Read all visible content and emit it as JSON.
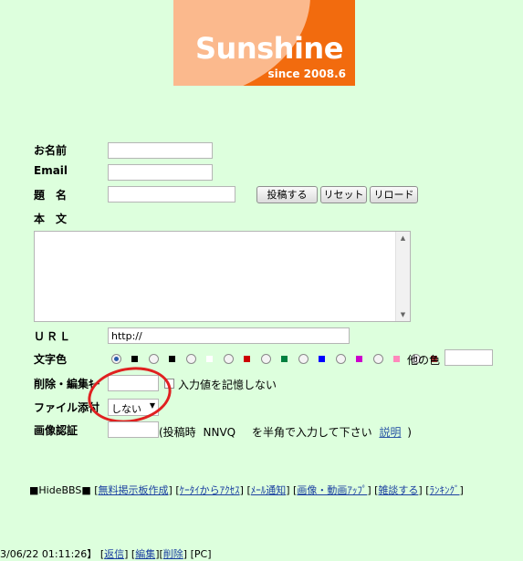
{
  "logo": {
    "brand": "Sunshine",
    "since": "since 2008.6"
  },
  "form": {
    "name_label": "お名前",
    "email_label": "Email",
    "subject_label": "題　名",
    "body_label": "本　文",
    "url_label": "ＵＲＬ",
    "url_value": "http://",
    "color_label": "文字色",
    "color_options": [
      "#000000",
      "#000000",
      "#ffffff",
      "#cc0000",
      "#008040",
      "#0000ff",
      "#cc00cc",
      "#ff88bb",
      "#993333"
    ],
    "other_color_label": "他の色",
    "delete_key_label": "削除・編集ｷｰ",
    "remember_label": "入力値を記憶しない",
    "file_label": "ファイル添付",
    "file_select_value": "しない",
    "captcha_label": "画像認証",
    "captcha_hint_pre": "(投稿時",
    "captcha_code": "NNVQ",
    "captcha_hint_post": "を半角で入力して下さい",
    "captcha_link": "説明",
    "captcha_close": ")"
  },
  "buttons": {
    "submit": "投稿する",
    "reset": "リセット",
    "reload": "リロード"
  },
  "footer": {
    "prefix": "■HideBBS■",
    "links": [
      "無料掲示板作成",
      "ｹｰﾀｲからｱｸｾｽ",
      "ﾒｰﾙ通知",
      "画像・動画ｱｯﾌﾟ",
      "雑談する",
      "ﾗﾝｷﾝｸﾞ"
    ]
  },
  "bottom_row": {
    "date_text": "3/06/22 01:11:26】",
    "links": [
      "返信",
      "編集",
      "削除"
    ],
    "pc": "[PC]"
  }
}
